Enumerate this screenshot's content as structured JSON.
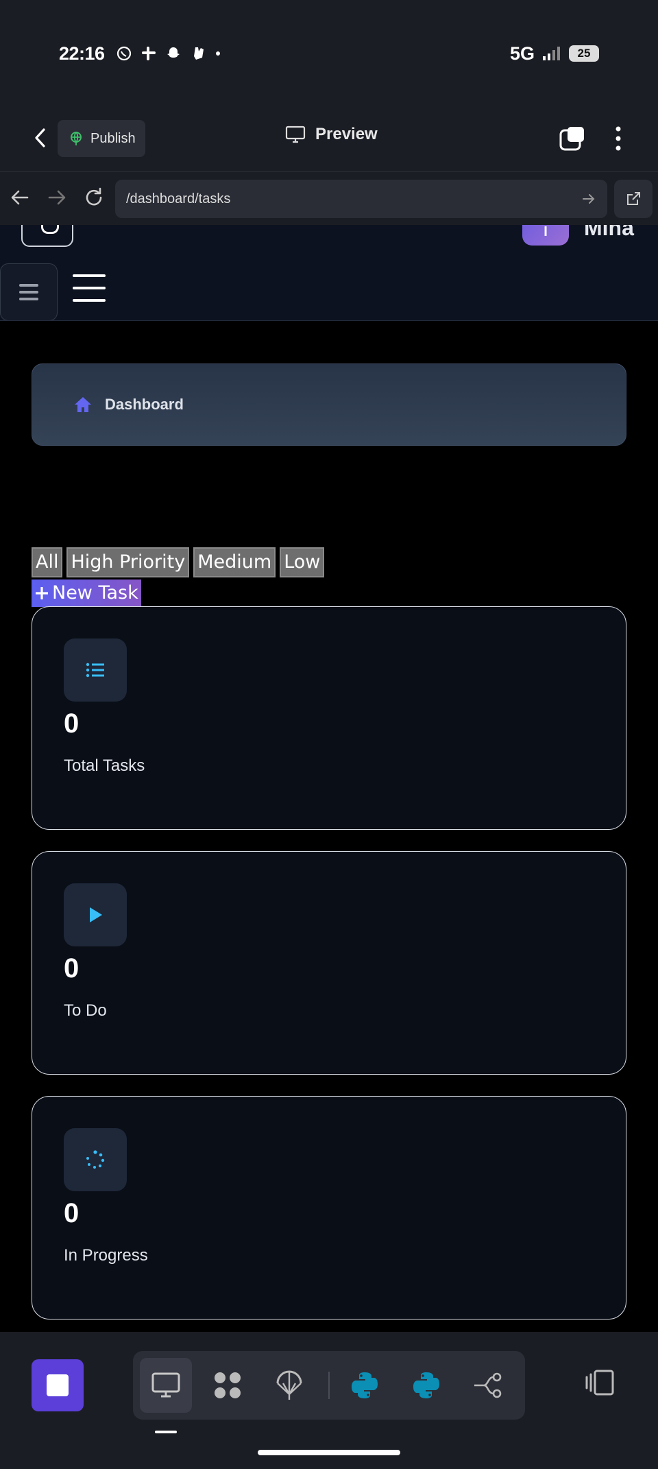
{
  "status_bar": {
    "time": "22:16",
    "network": "5G",
    "battery": "25"
  },
  "app_header": {
    "publish_label": "Publish",
    "preview_label": "Preview"
  },
  "browser": {
    "url": "/dashboard/tasks"
  },
  "navbar": {
    "username_partial": "Mina",
    "avatar_initial": "I"
  },
  "breadcrumb": {
    "label": "Dashboard"
  },
  "filters": [
    "All",
    "High Priority",
    "Medium",
    "Low"
  ],
  "new_task_label": "New Task",
  "stats": [
    {
      "icon": "list-icon",
      "value": "0",
      "label": "Total Tasks"
    },
    {
      "icon": "play-icon",
      "value": "0",
      "label": "To Do"
    },
    {
      "icon": "spinner-icon",
      "value": "0",
      "label": "In Progress"
    }
  ],
  "colors": {
    "accent": "#5b5ff0",
    "icon_blue": "#38bdf8",
    "card_bg": "#0a0e17",
    "stop_button": "#5b3fd8",
    "python": "#0b8fb5"
  }
}
